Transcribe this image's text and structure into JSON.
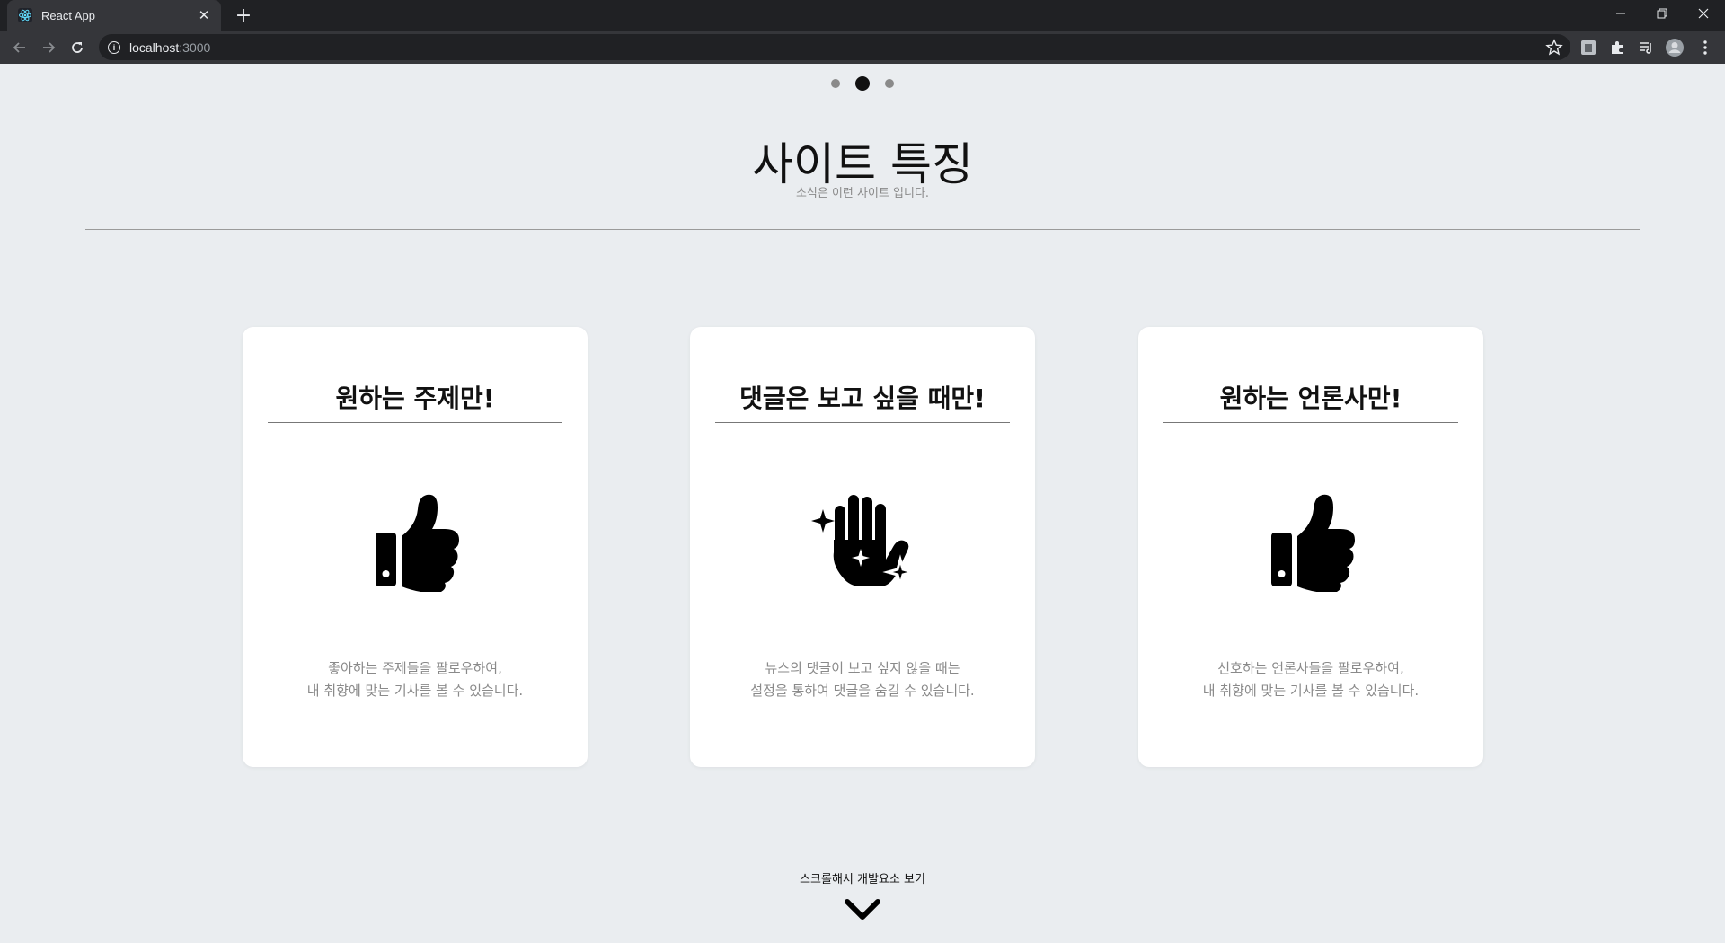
{
  "browser": {
    "tab_title": "React App",
    "url_host": "localhost",
    "url_port": ":3000"
  },
  "slider": {
    "dot_count": 3,
    "active_index": 1
  },
  "header": {
    "title": "사이트 특징",
    "subtitle": "소식은 이런 사이트 입니다."
  },
  "cards": [
    {
      "title": "원하는 주제만!",
      "icon": "thumbs-up-icon",
      "desc_line1": "좋아하는 주제들을 팔로우하여,",
      "desc_line2": "내 취향에 맞는 기사를 볼 수 있습니다."
    },
    {
      "title": "댓글은 보고 싶을 때만!",
      "icon": "hand-sparkles-icon",
      "desc_line1": "뉴스의 댓글이 보고 싶지 않을 때는",
      "desc_line2": "설정을 통하여 댓글을 숨길 수 있습니다."
    },
    {
      "title": "원하는 언론사만!",
      "icon": "thumbs-up-icon",
      "desc_line1": "선호하는 언론사들을 팔로우하여,",
      "desc_line2": "내 취향에 맞는 기사를 볼 수 있습니다."
    }
  ],
  "footer": {
    "scroll_hint": "스크롤해서 개발요소 보기",
    "icon": "chevron-down-icon"
  },
  "colors": {
    "page_bg": "#eaedf0",
    "card_bg": "#ffffff",
    "text_dark": "#111111",
    "text_muted": "#8a8a8a"
  }
}
